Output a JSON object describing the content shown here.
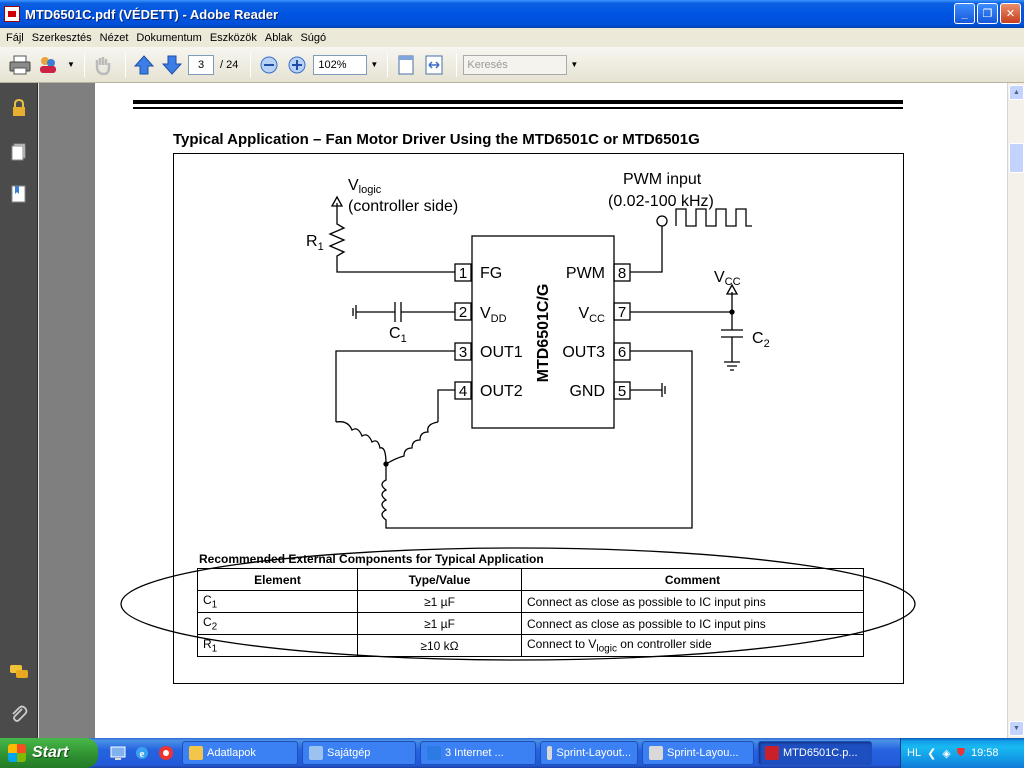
{
  "window": {
    "title": "MTD6501C.pdf (VÉDETT) - Adobe Reader",
    "minimize": "_",
    "restore": "❐",
    "close": "✕"
  },
  "menu": [
    "Fájl",
    "Szerkesztés",
    "Nézet",
    "Dokumentum",
    "Eszközök",
    "Ablak",
    "Súgó"
  ],
  "toolbar": {
    "page_current": "3",
    "page_total": "/ 24",
    "zoom": "102%",
    "search_placeholder": "Keresés"
  },
  "document": {
    "heading": "Typical Application – Fan Motor Driver Using the MTD6501C or MTD6501G",
    "schematic": {
      "chip": "MTD6501C/G",
      "vlogic": "V",
      "vlogic_sub": "logic",
      "controller_side": "(controller side)",
      "r1": "R",
      "r1_sub": "1",
      "c1": "C",
      "c1_sub": "1",
      "c2": "C",
      "c2_sub": "2",
      "vcc_top": "V",
      "vcc_top_sub": "CC",
      "pwm_input": "PWM input",
      "pwm_freq": "(0.02-100 kHz)",
      "pins_left": [
        {
          "num": "1",
          "label": "FG",
          "sub": ""
        },
        {
          "num": "2",
          "label": "V",
          "sub": "DD"
        },
        {
          "num": "3",
          "label": "OUT1",
          "sub": ""
        },
        {
          "num": "4",
          "label": "OUT2",
          "sub": ""
        }
      ],
      "pins_right": [
        {
          "num": "8",
          "label": "PWM",
          "sub": ""
        },
        {
          "num": "7",
          "label": "V",
          "sub": "CC"
        },
        {
          "num": "6",
          "label": "OUT3",
          "sub": ""
        },
        {
          "num": "5",
          "label": "GND",
          "sub": ""
        }
      ]
    },
    "table": {
      "title": "Recommended External Components for Typical Application",
      "headers": [
        "Element",
        "Type/Value",
        "Comment"
      ],
      "rows": [
        {
          "element": "C",
          "element_sub": "1",
          "value": "≥1 µF",
          "comment": "Connect as close as possible to IC input pins",
          "comment_sub": "",
          "comment_tail": ""
        },
        {
          "element": "C",
          "element_sub": "2",
          "value": "≥1 µF",
          "comment": "Connect as close as possible to IC input pins",
          "comment_sub": "",
          "comment_tail": ""
        },
        {
          "element": "R",
          "element_sub": "1",
          "value": "≥10 kΩ",
          "comment": "Connect to V",
          "comment_sub": "logic",
          "comment_tail": " on controller side"
        }
      ]
    }
  },
  "taskbar": {
    "start": "Start",
    "tasks": [
      {
        "label": "Adatlapok",
        "color": "#f3c64a"
      },
      {
        "label": "Sajátgép",
        "color": "#9cc3ef"
      },
      {
        "label": "3 Internet ...",
        "color": "#2c7be5"
      },
      {
        "label": "Sprint-Layout...",
        "color": "#d9d9d9"
      },
      {
        "label": "Sprint-Layou...",
        "color": "#d9d9d9"
      },
      {
        "label": "MTD6501C.p...",
        "color": "#c9202a"
      }
    ],
    "lang": "HL",
    "clock": "19:58"
  },
  "colors": {
    "titlebar": "#0054e3",
    "taskbar": "#245edb",
    "leftpanel": "#4b4b4b",
    "doc_bg": "#7f7f7f"
  }
}
